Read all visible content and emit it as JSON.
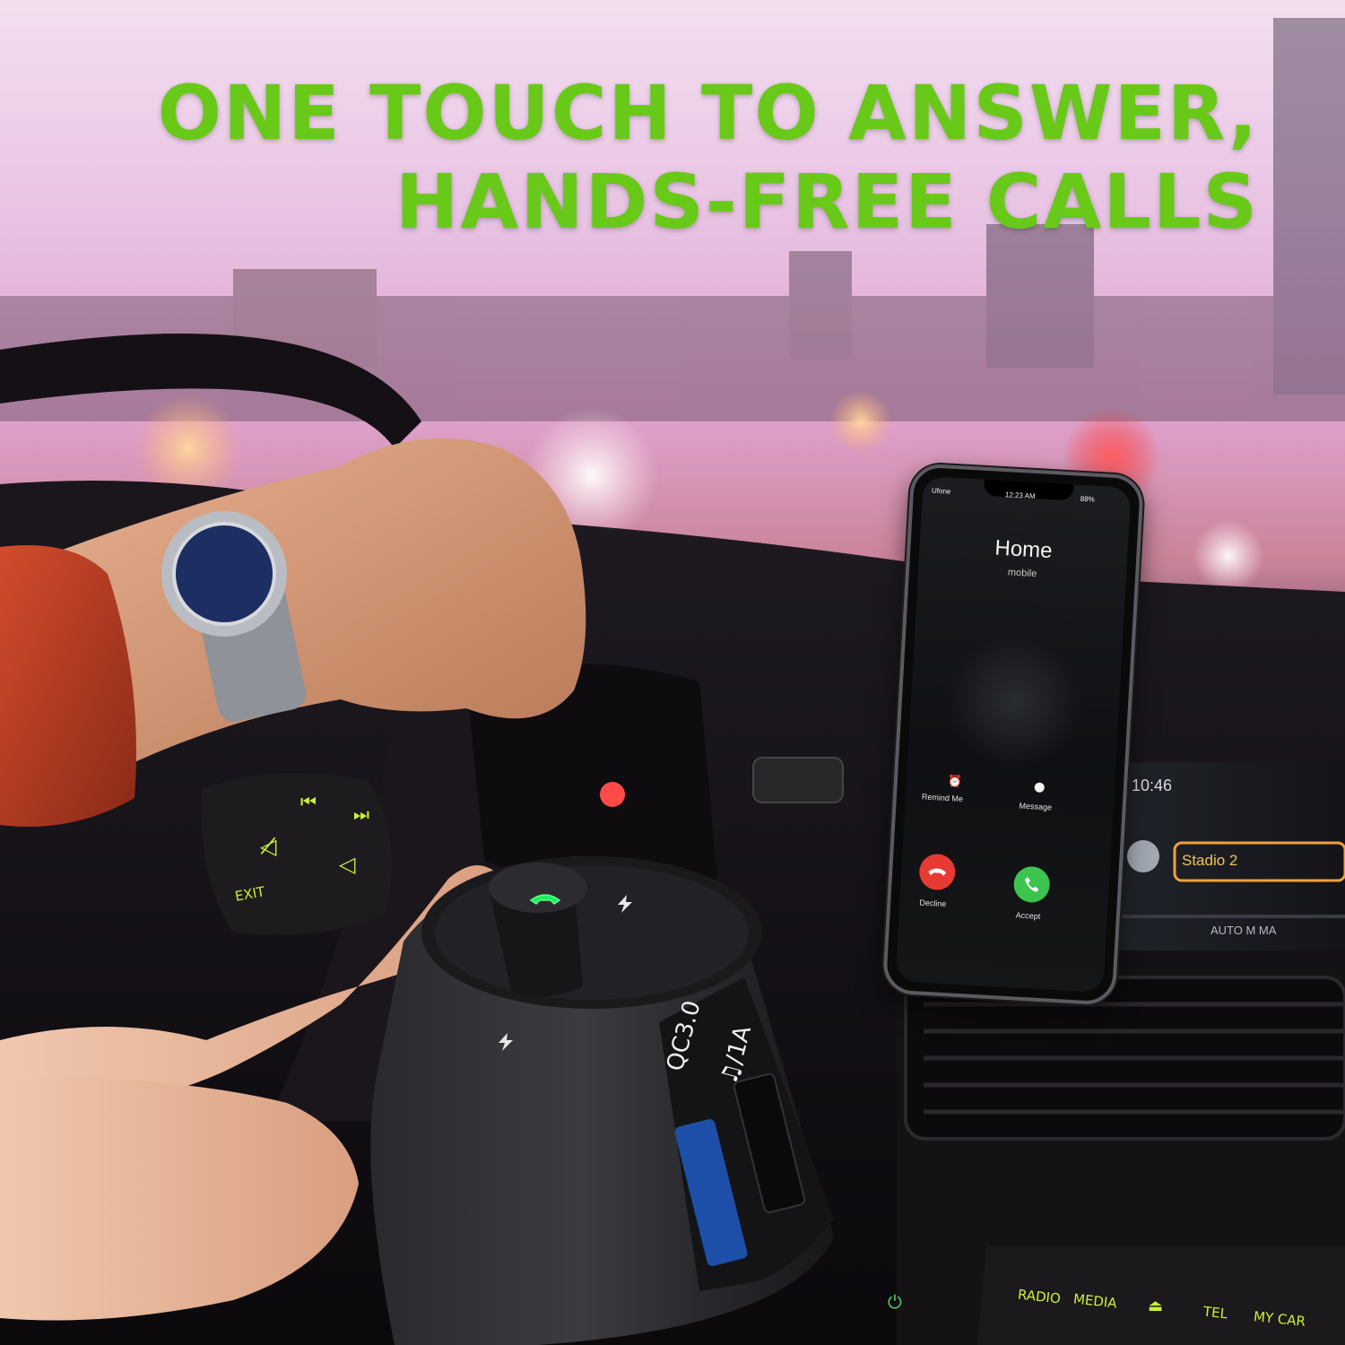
{
  "headline": {
    "line1": "ONE TOUCH TO ANSWER,",
    "line2": "HANDS-FREE CALLS",
    "color": "#69c919"
  },
  "phone": {
    "carrier": "Ufone",
    "time": "12:23 AM",
    "battery": "88%",
    "caller_name": "Home",
    "caller_label": "mobile",
    "remind_label": "Remind Me",
    "message_label": "Message",
    "decline_label": "Decline",
    "accept_label": "Accept",
    "decline_color": "#e63a33",
    "accept_color": "#3cc44e",
    "icons": [
      "alarm-icon",
      "message-icon",
      "phone-decline-icon",
      "phone-accept-icon",
      "wifi-icon",
      "signal-icon"
    ]
  },
  "charger": {
    "qc_label": "QC3.0",
    "port_label": "♫/1A",
    "icons": [
      "phone-button-icon",
      "lightning-icon",
      "usb-port-icon"
    ]
  },
  "steering_controls": {
    "exit_label": "EXIT",
    "icons": [
      "previous-track-icon",
      "next-track-icon",
      "mute-icon",
      "volume-icon"
    ]
  },
  "dashboard": {
    "radio_label": "RADIO",
    "media_label": "MEDIA",
    "tel_label": "TEL",
    "mycar_label": "MY CAR",
    "display_time": "10:46",
    "display_station": "Stadio 2",
    "display_band": "AUTO M MA",
    "icons": [
      "power-icon",
      "eject-icon"
    ]
  }
}
